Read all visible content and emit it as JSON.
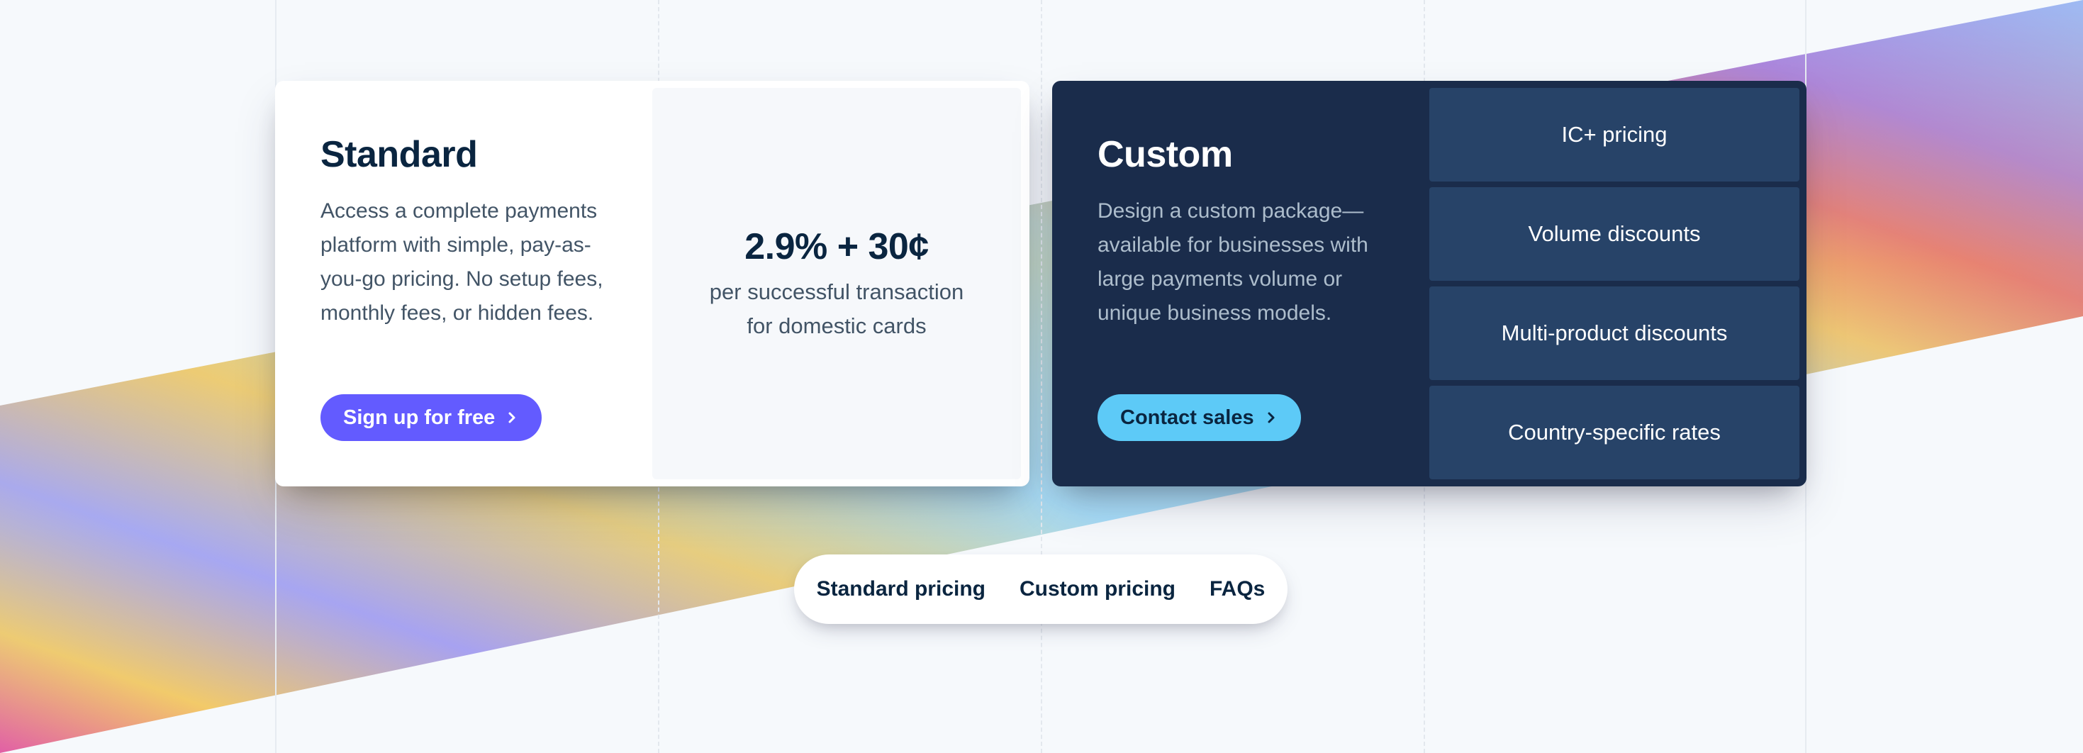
{
  "standard": {
    "title": "Standard",
    "description": "Access a complete payments platform with simple, pay-as-you-go pricing. No setup fees, monthly fees, or hidden fees.",
    "button_label": "Sign up for free",
    "price": "2.9% + 30¢",
    "price_note": "per successful transaction for domestic cards"
  },
  "custom": {
    "title": "Custom",
    "description": "Design a custom package—available for businesses with large payments volume or unique business models.",
    "button_label": "Contact sales",
    "features": [
      "IC+ pricing",
      "Volume discounts",
      "Multi-product discounts",
      "Country-specific rates"
    ]
  },
  "bottom_nav": {
    "links": [
      "Standard pricing",
      "Custom pricing",
      "FAQs"
    ]
  },
  "colors": {
    "accent": "#635bff",
    "dark_card": "#1a2c4b",
    "feature_tile": "#274368",
    "contact_button": "#5dcaf7"
  },
  "icons": {
    "button_arrow": "chevron-right-icon"
  }
}
